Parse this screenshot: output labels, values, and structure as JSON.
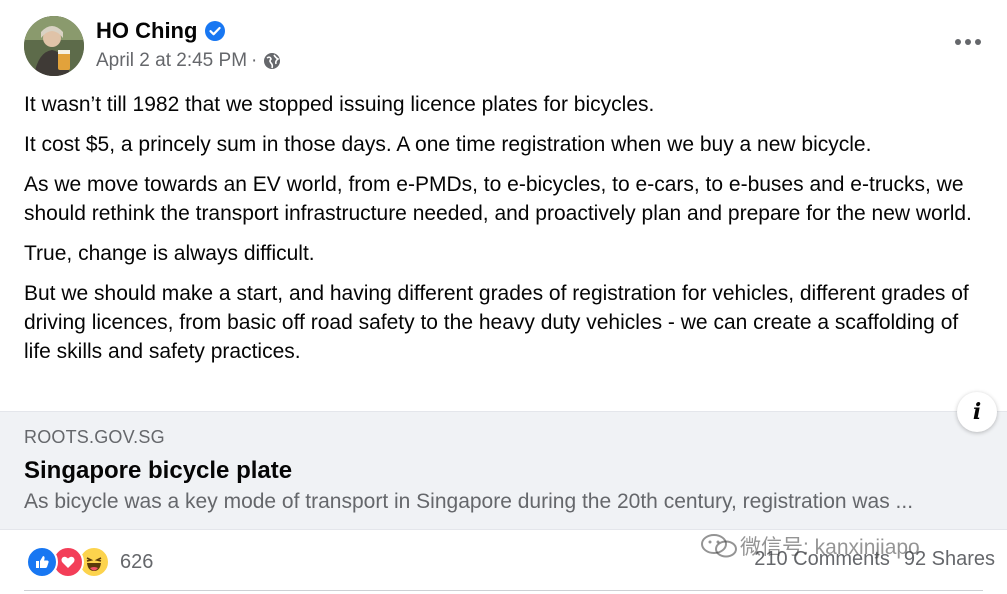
{
  "author": {
    "name": "HO Ching",
    "verified_icon": "verified-badge-icon",
    "timestamp": "April 2 at 2:45 PM",
    "separator": "·",
    "audience_icon": "globe-icon"
  },
  "post": {
    "paragraphs": [
      "It wasn’t till 1982 that we stopped issuing licence plates for bicycles.",
      "It cost $5, a princely sum in those days. A one time registration when we buy a new bicycle.",
      "As we move towards an EV world, from e-PMDs, to e-bicycles, to e-cars, to e-buses and e-trucks, we should rethink the transport infrastructure needed, and proactively plan and prepare for the new world.",
      "True, change is always difficult.",
      "But we should make a start, and having different grades of registration for vehicles, different grades of driving licences, from basic off road safety to the heavy duty vehicles - we can create a scaffolding of life skills and safety practices."
    ]
  },
  "link_preview": {
    "domain": "ROOTS.GOV.SG",
    "title": "Singapore bicycle plate",
    "description": "As bicycle was a key mode of transport in Singapore during the 20th century, registration was ...",
    "info_label": "i"
  },
  "engagement": {
    "reaction_icons": [
      "like-icon",
      "love-icon",
      "haha-icon"
    ],
    "reaction_count": "626",
    "comments": "210 Comments",
    "shares": "92 Shares"
  },
  "watermark": {
    "text": "微信号: kanxinjiapo"
  },
  "colors": {
    "accent": "#1877f2",
    "secondary_text": "#65676b",
    "card_bg": "#f0f2f5",
    "love": "#f33e58",
    "haha": "#fcd34d"
  }
}
